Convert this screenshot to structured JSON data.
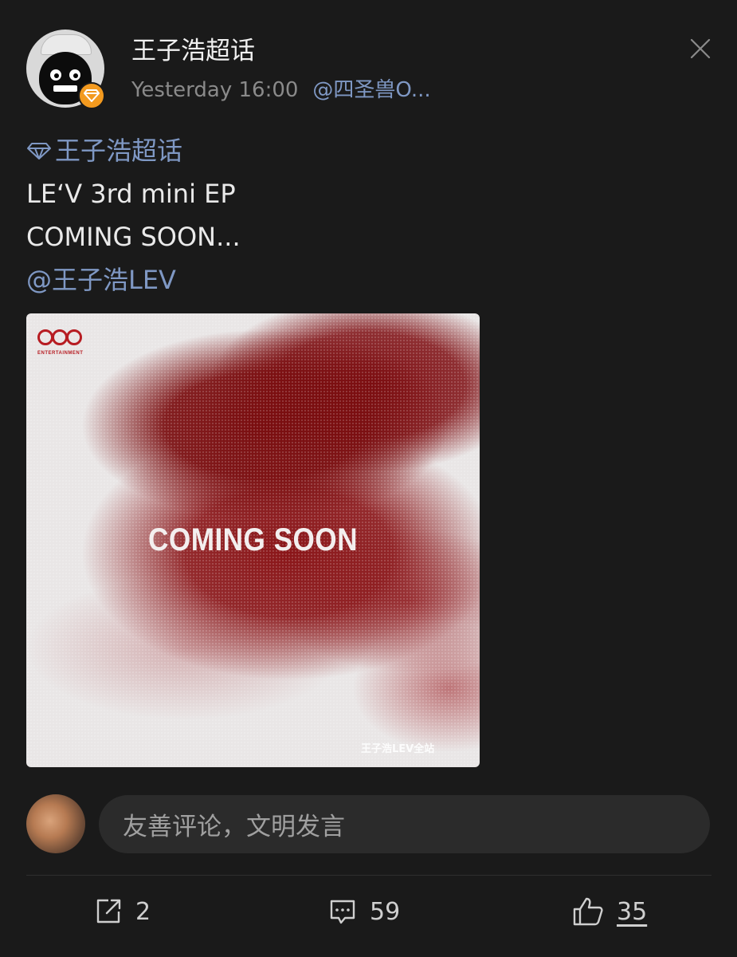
{
  "post": {
    "username": "王子浩超话",
    "time": "Yesterday 16:00",
    "source": "@四圣兽O...",
    "lines": {
      "supertopic": "王子浩超话",
      "line1": "LE‘V 3rd mini EP",
      "line2": "COMING SOON...",
      "mention": "@王子浩LEV"
    },
    "image": {
      "logo_text": "ENTERTAINMENT",
      "title": "COMING SOON",
      "watermark": "王子浩LEV全站"
    }
  },
  "comment": {
    "placeholder": "友善评论，文明发言"
  },
  "actions": {
    "repost_count": "2",
    "comment_count": "59",
    "like_count": "35"
  },
  "colors": {
    "background": "#1a1a1a",
    "link": "#7f98c4",
    "badge": "#f39a1f",
    "image_red": "#7a0d0f"
  }
}
